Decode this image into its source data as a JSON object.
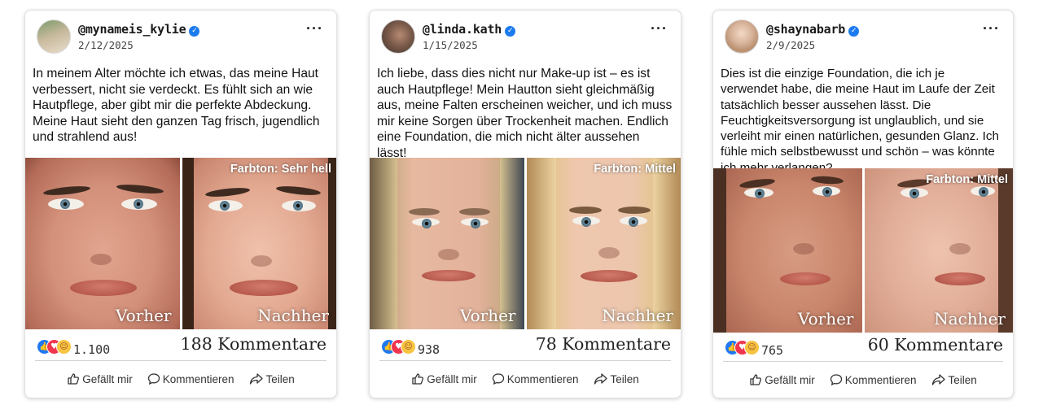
{
  "posts": [
    {
      "username": "@mynameis_kylie",
      "date": "2/12/2025",
      "text": "In meinem Alter möchte ich etwas, das meine Haut verbessert, nicht sie verdeckt. Es fühlt sich an wie Hautpflege, aber gibt mir die perfekte Abdeckung. Meine Haut sieht den ganzen Tag frisch, jugendlich und strahlend aus!",
      "shade": "Farbton: Sehr hell",
      "before": "Vorher",
      "after": "Nachher",
      "reactions": "1.100",
      "comments": "188 Kommentare"
    },
    {
      "username": "@linda.kath",
      "date": "1/15/2025",
      "text": "Ich liebe, dass dies nicht nur Make-up ist – es ist auch Hautpflege! Mein Hautton sieht gleichmäßig aus, meine Falten erscheinen weicher, und ich muss mir keine Sorgen über Trockenheit machen. Endlich eine Foundation, die mich nicht älter aussehen lässt!",
      "shade": "Farbton: Mittel",
      "before": "Vorher",
      "after": "Nachher",
      "reactions": "938",
      "comments": "78 Kommentare"
    },
    {
      "username": "@shaynabarb",
      "date": "2/9/2025",
      "text": "Dies ist die einzige Foundation, die ich je verwendet habe, die meine Haut im Laufe der Zeit tatsächlich besser aussehen lässt. Die Feuchtigkeitsversorgung ist unglaublich, und sie verleiht mir einen natürlichen, gesunden Glanz. Ich fühle mich selbstbewusst und schön – was könnte ich mehr verlangen?",
      "shade": "Farbton: Mittel",
      "before": "Vorher",
      "after": "Nachher",
      "reactions": "765",
      "comments": "60 Kommentare"
    }
  ],
  "actions": {
    "like": "Gefällt mir",
    "comment": "Kommentieren",
    "share": "Teilen"
  },
  "icons": {
    "verified": "verified-badge-icon",
    "more": "more-options-icon",
    "reactions": [
      "like-reaction-icon",
      "love-reaction-icon",
      "care-reaction-icon"
    ],
    "like": "thumbs-up-icon",
    "comment": "comment-bubble-icon",
    "share": "share-arrow-icon"
  },
  "colors": {
    "verified": "#1d7bf0",
    "like": "#1f78f2",
    "love": "#f0364f",
    "care": "#f7c440"
  }
}
